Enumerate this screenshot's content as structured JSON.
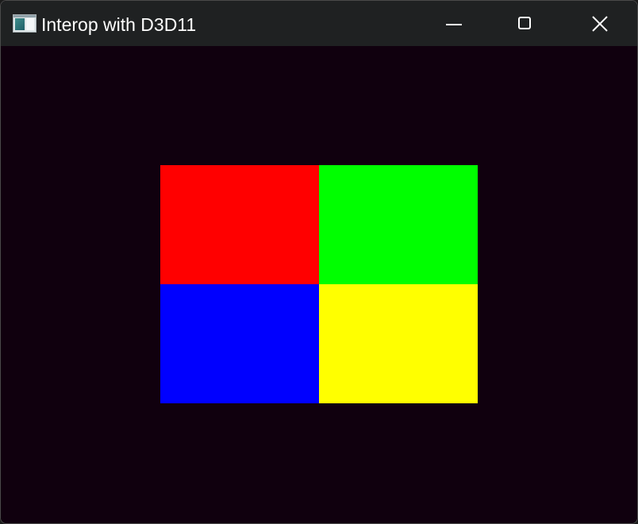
{
  "window": {
    "title": "Interop with D3D11",
    "app_icon": "application-window-icon",
    "controls": {
      "minimize_icon": "minimize-icon",
      "maximize_icon": "maximize-icon",
      "close_icon": "close-icon"
    }
  },
  "scene": {
    "background_color": "#10000e",
    "quadrants": [
      {
        "name": "top-left",
        "color": "#ff0000"
      },
      {
        "name": "top-right",
        "color": "#00ff00"
      },
      {
        "name": "bottom-left",
        "color": "#0000ff"
      },
      {
        "name": "bottom-right",
        "color": "#ffff00"
      }
    ]
  }
}
